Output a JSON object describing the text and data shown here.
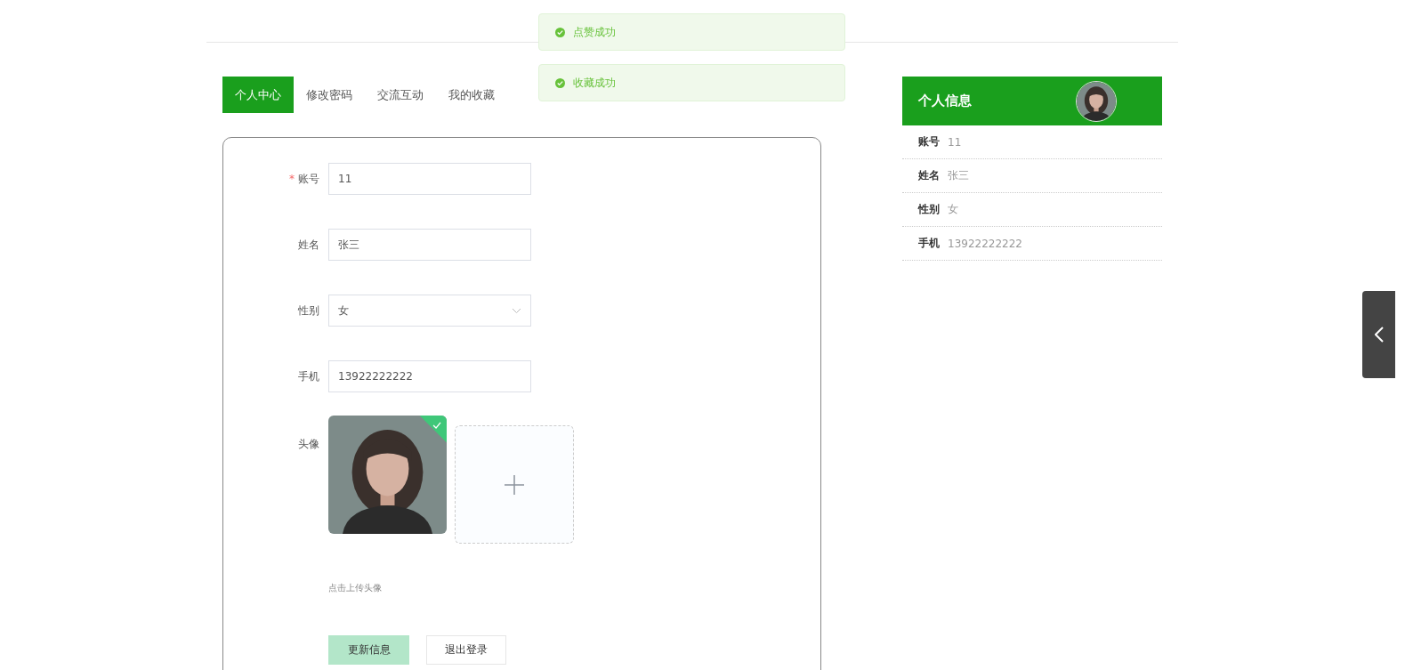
{
  "toasts": [
    {
      "text": "点赞成功"
    },
    {
      "text": "收藏成功"
    }
  ],
  "tabs": [
    {
      "label": "个人中心",
      "selected": true
    },
    {
      "label": "修改密码",
      "selected": false
    },
    {
      "label": "交流互动",
      "selected": false
    },
    {
      "label": "我的收藏",
      "selected": false
    }
  ],
  "form": {
    "fields": [
      {
        "kind": "input",
        "label": "账号",
        "required_mark": "*",
        "value": "11"
      },
      {
        "kind": "input",
        "label": "姓名",
        "value": "张三"
      },
      {
        "kind": "select",
        "label": "性别",
        "value": "女"
      },
      {
        "kind": "input",
        "label": "手机",
        "value": "13922222222"
      }
    ],
    "avatar": {
      "label": "头像",
      "success": true,
      "hint": "点击上传头像"
    },
    "buttons": [
      {
        "label": "更新信息",
        "kind": "primary"
      },
      {
        "label": "退出登录",
        "kind": "default"
      }
    ]
  },
  "profile": {
    "title": "个人信息",
    "rows": [
      {
        "label": "账号",
        "value": "11"
      },
      {
        "label": "姓名",
        "value": "张三"
      },
      {
        "label": "性别",
        "value": "女"
      },
      {
        "label": "手机",
        "value": "13922222222"
      }
    ]
  }
}
